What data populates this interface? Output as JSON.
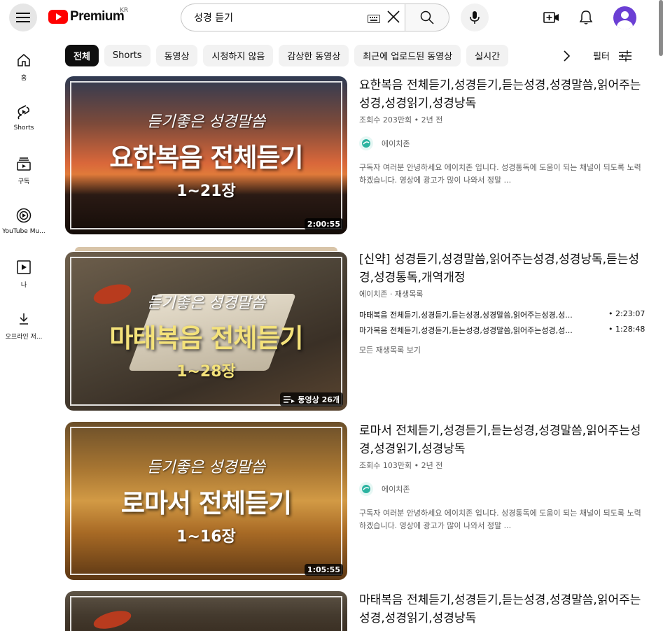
{
  "header": {
    "logo_text": "Premium",
    "region": "KR",
    "search_value": "성경 듣기"
  },
  "sidebar": {
    "items": [
      {
        "label": "홈"
      },
      {
        "label": "Shorts"
      },
      {
        "label": "구독"
      },
      {
        "label": "YouTube Mu..."
      },
      {
        "label": "나"
      },
      {
        "label": "오프라인 저..."
      }
    ]
  },
  "chips": [
    "전체",
    "Shorts",
    "동영상",
    "시청하지 않음",
    "감상한 동영상",
    "최근에 업로드된 동영상",
    "실시간"
  ],
  "filter_label": "필터",
  "results": [
    {
      "thumb": {
        "tag": "듣기좋은 성경말씀",
        "big": "요한복음 전체듣기",
        "sub": "1~21장"
      },
      "duration": "2:00:55",
      "title": "요한복음 전체듣기,성경듣기,듣는성경,성경말씀,읽어주는성경,성경읽기,성경낭독",
      "meta": "조회수 203만회 • 2년 전",
      "channel": "에이치존",
      "desc": "구독자 여러분 안녕하세요 에이치존 입니다. 성경통독에 도움이 되는 채널이 되도록 노력하겠습니다. 영상에 광고가 많이 나와서 정말 ..."
    },
    {
      "thumb": {
        "tag": "듣기좋은 성경말씀",
        "big": "마태복음 전체듣기",
        "sub": "1~28장"
      },
      "badge": "동영상 26개",
      "title": "[신약] 성경듣기,성경말씀,읽어주는성경,성경낭독,듣는성경,성경통독,개역개정",
      "meta": "에이치존 · 재생목록",
      "items": [
        {
          "title": "마태복음 전체듣기,성경듣기,듣는성경,성경말씀,읽어주는성경,성...",
          "duration": "• 2:23:07"
        },
        {
          "title": "마가복음 전체듣기,성경듣기,듣는성경,성경말씀,읽어주는성경,성...",
          "duration": "• 1:28:48"
        }
      ],
      "view_all": "모든 재생목록 보기"
    },
    {
      "thumb": {
        "tag": "듣기좋은 성경말씀",
        "big": "로마서 전체듣기",
        "sub": "1~16장"
      },
      "duration": "1:05:55",
      "title": "로마서 전체듣기,성경듣기,듣는성경,성경말씀,읽어주는성경,성경읽기,성경낭독",
      "meta": "조회수 103만회 • 2년 전",
      "channel": "에이치존",
      "desc": "구독자 여러분 안녕하세요 에이치존 입니다. 성경통독에 도움이 되는 채널이 되도록 노력하겠습니다. 영상에 광고가 많이 나와서 정말 ..."
    },
    {
      "title": "마태복음 전체듣기,성경듣기,듣는성경,성경말씀,읽어주는성경,성경읽기,성경낭독"
    }
  ]
}
